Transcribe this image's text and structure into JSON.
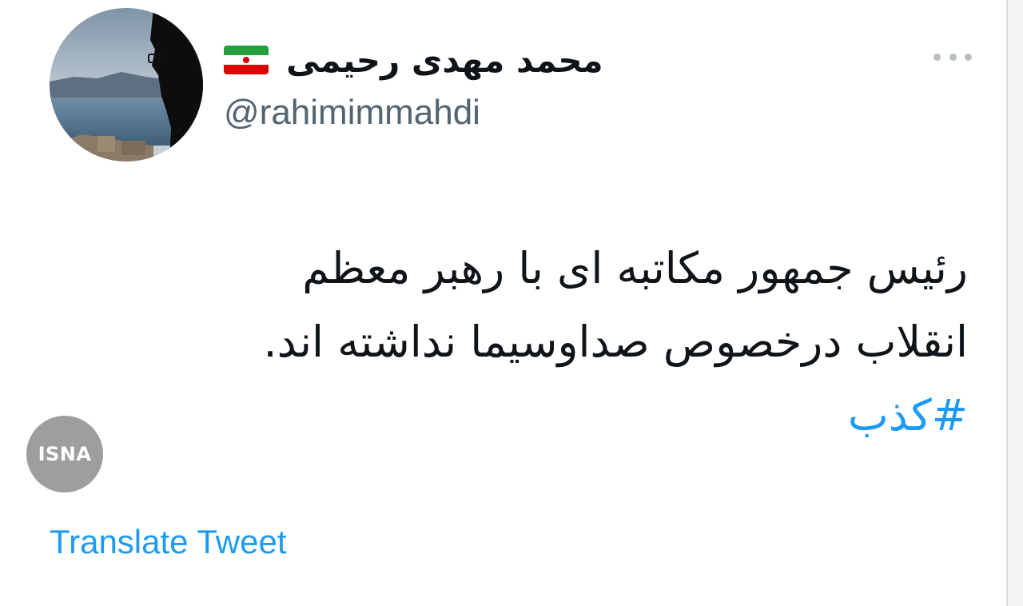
{
  "tweet": {
    "display_name": "محمد مهدی رحیمی",
    "handle": "@rahimimmahdi",
    "text_lines": [
      "رئیس جمهور مکاتبه ای با رهبر معظم",
      "انقلاب درخصوص صداوسیما نداشته اند."
    ],
    "hashtag": "#کذب",
    "translate_label": "Translate Tweet"
  },
  "icons": {
    "flag": "iran-flag-emoji",
    "more": "more-options-icon"
  },
  "watermark": {
    "text": "ISNA"
  },
  "colors": {
    "link": "#1d9bf0",
    "text": "#0f1419",
    "secondary": "#536471",
    "watermark_bg": "#9e9e9e"
  }
}
